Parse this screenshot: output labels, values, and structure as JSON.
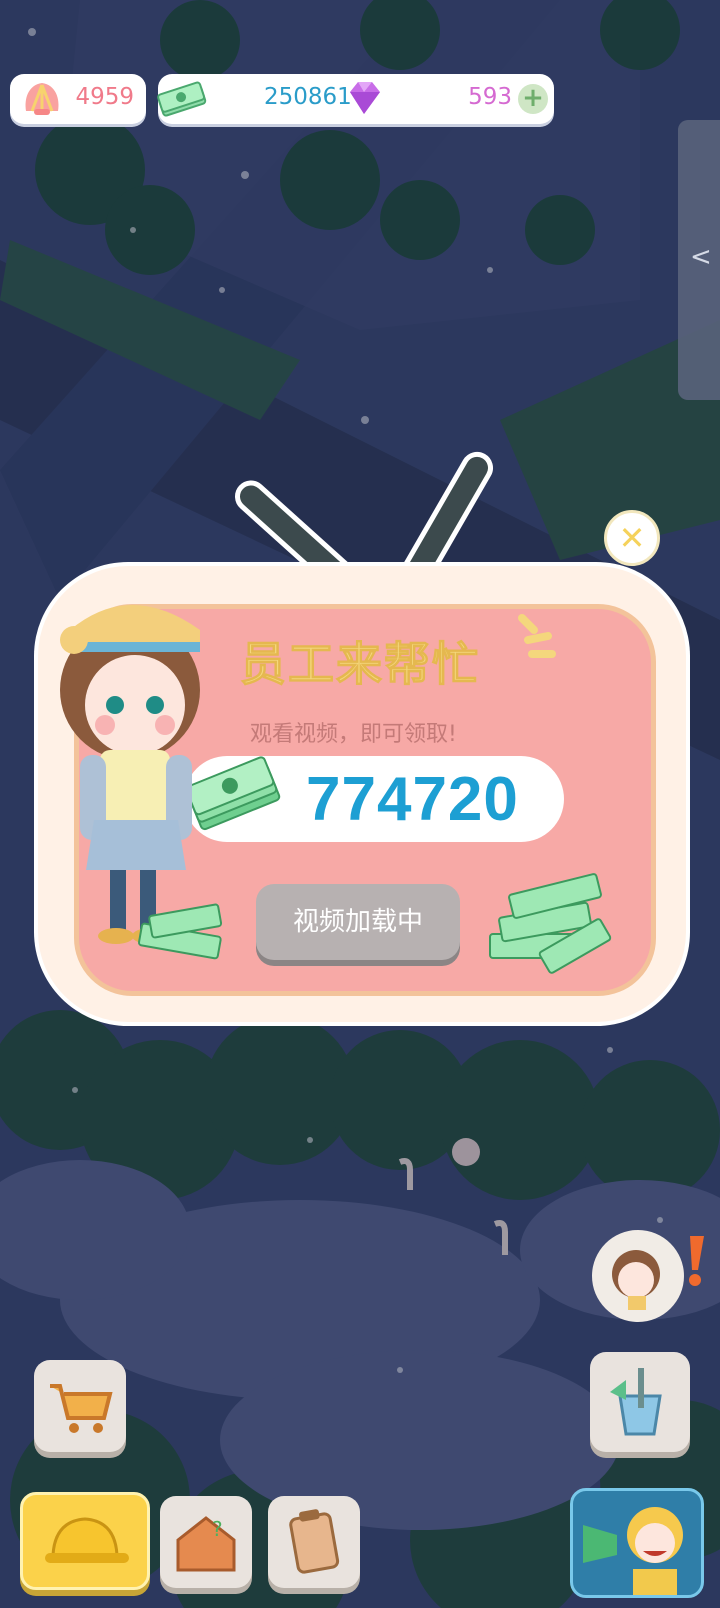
{
  "resources": {
    "shells": "4959",
    "money": "250861",
    "gems": "593",
    "add_label": "+"
  },
  "side_tab": {
    "arrow": "<"
  },
  "popup": {
    "title": "员工来帮忙",
    "subtitle": "观看视频，即可领取!",
    "reward_amount": "774720",
    "button_label": "视频加载中",
    "close_icon": "close-icon"
  },
  "bottom_bar": {
    "left": [
      "shopping-cart-icon",
      "hard-hat-icon",
      "toolbox-icon",
      "clipboard-icon"
    ],
    "right": [
      "bucket-icon",
      "megaphone-character-icon"
    ]
  },
  "colors": {
    "popup_bg": "#f7a9a6",
    "title": "#f4d77d",
    "amount": "#1d9fd3",
    "button": "#b7b1b1"
  }
}
